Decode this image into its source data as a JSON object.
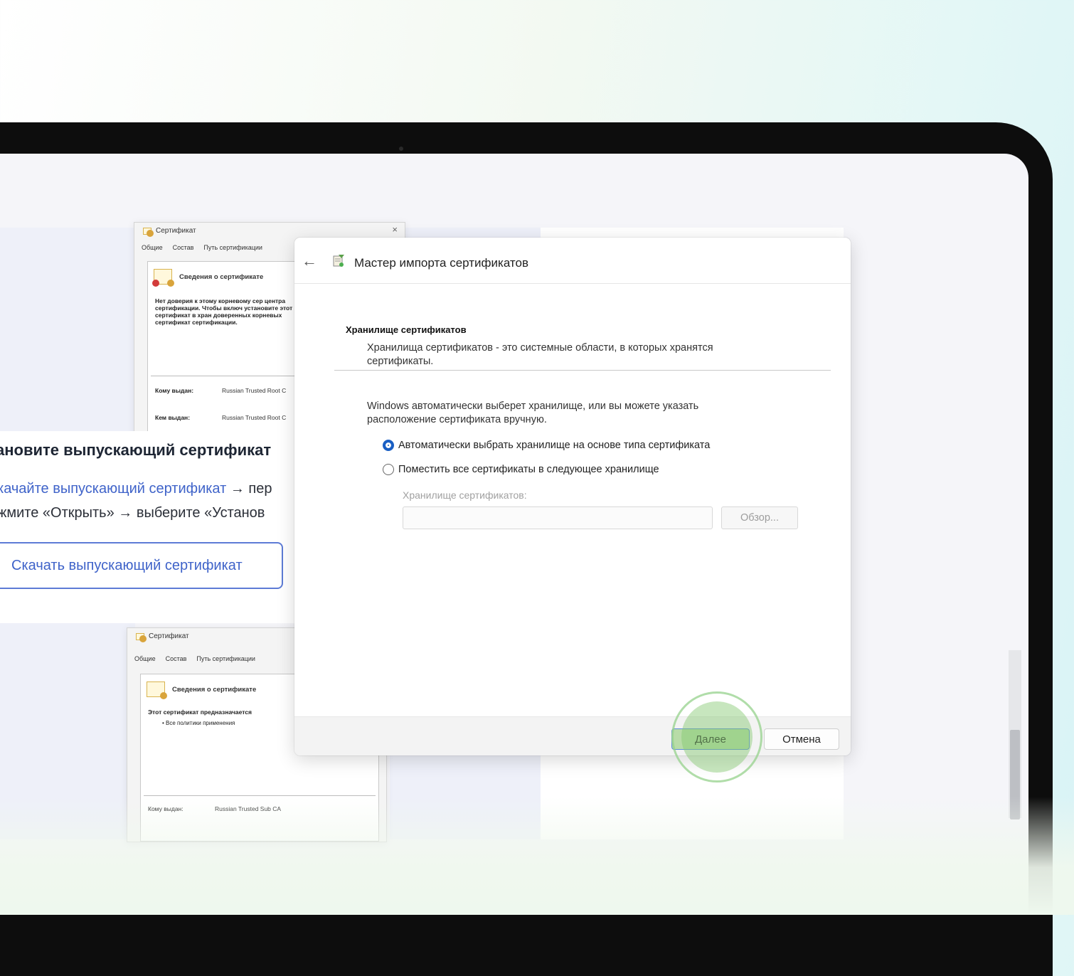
{
  "background_cert_top": {
    "title": "Сертификат",
    "tabs": [
      "Общие",
      "Состав",
      "Путь сертификации"
    ],
    "header": "Сведения о сертификате",
    "body": "Нет доверия к этому корневому сер центра сертификации. Чтобы включ установите этот сертификат в хран доверенных корневых сертификат сертификации.",
    "issued_to_label": "Кому выдан:",
    "issued_to_value": "Russian Trusted Root C",
    "issued_by_label": "Кем выдан:",
    "issued_by_value": "Russian Trusted Root C"
  },
  "background_cert_bottom": {
    "title": "Сертификат",
    "tabs": [
      "Общие",
      "Состав",
      "Путь сертификации"
    ],
    "header": "Сведения о сертификате",
    "body": "Этот сертификат предназначается",
    "bullet": "• Все политики применения",
    "issued_to_label": "Кому выдан:",
    "issued_to_value": "Russian Trusted Sub CA"
  },
  "instructions": {
    "heading": "ановите выпускающий сертификат",
    "line1_link": "качайте выпускающий сертификат",
    "line1_rest": " → пер",
    "line2": "жмите «Открыть» → выберите «Установ",
    "download_button": "Скачать выпускающий сертификат"
  },
  "wizard": {
    "title": "Мастер импорта сертификатов",
    "section_title": "Хранилище сертификатов",
    "section_description": "Хранилища сертификатов - это системные области, в которых хранятся сертификаты.",
    "body_text": "Windows автоматически выберет хранилище, или вы можете указать расположение сертификата вручную.",
    "radio_auto": "Автоматически выбрать хранилище на основе типа сертификата",
    "radio_manual": "Поместить все сертификаты в следующее хранилище",
    "store_label": "Хранилище сертификатов:",
    "store_value": "",
    "browse_button": "Обзор...",
    "next_button": "Далее",
    "cancel_button": "Отмена",
    "selected_option": "auto"
  },
  "colors": {
    "accent": "#1a5fc4",
    "link": "#3f63c9",
    "highlight": "#b8dca8"
  }
}
